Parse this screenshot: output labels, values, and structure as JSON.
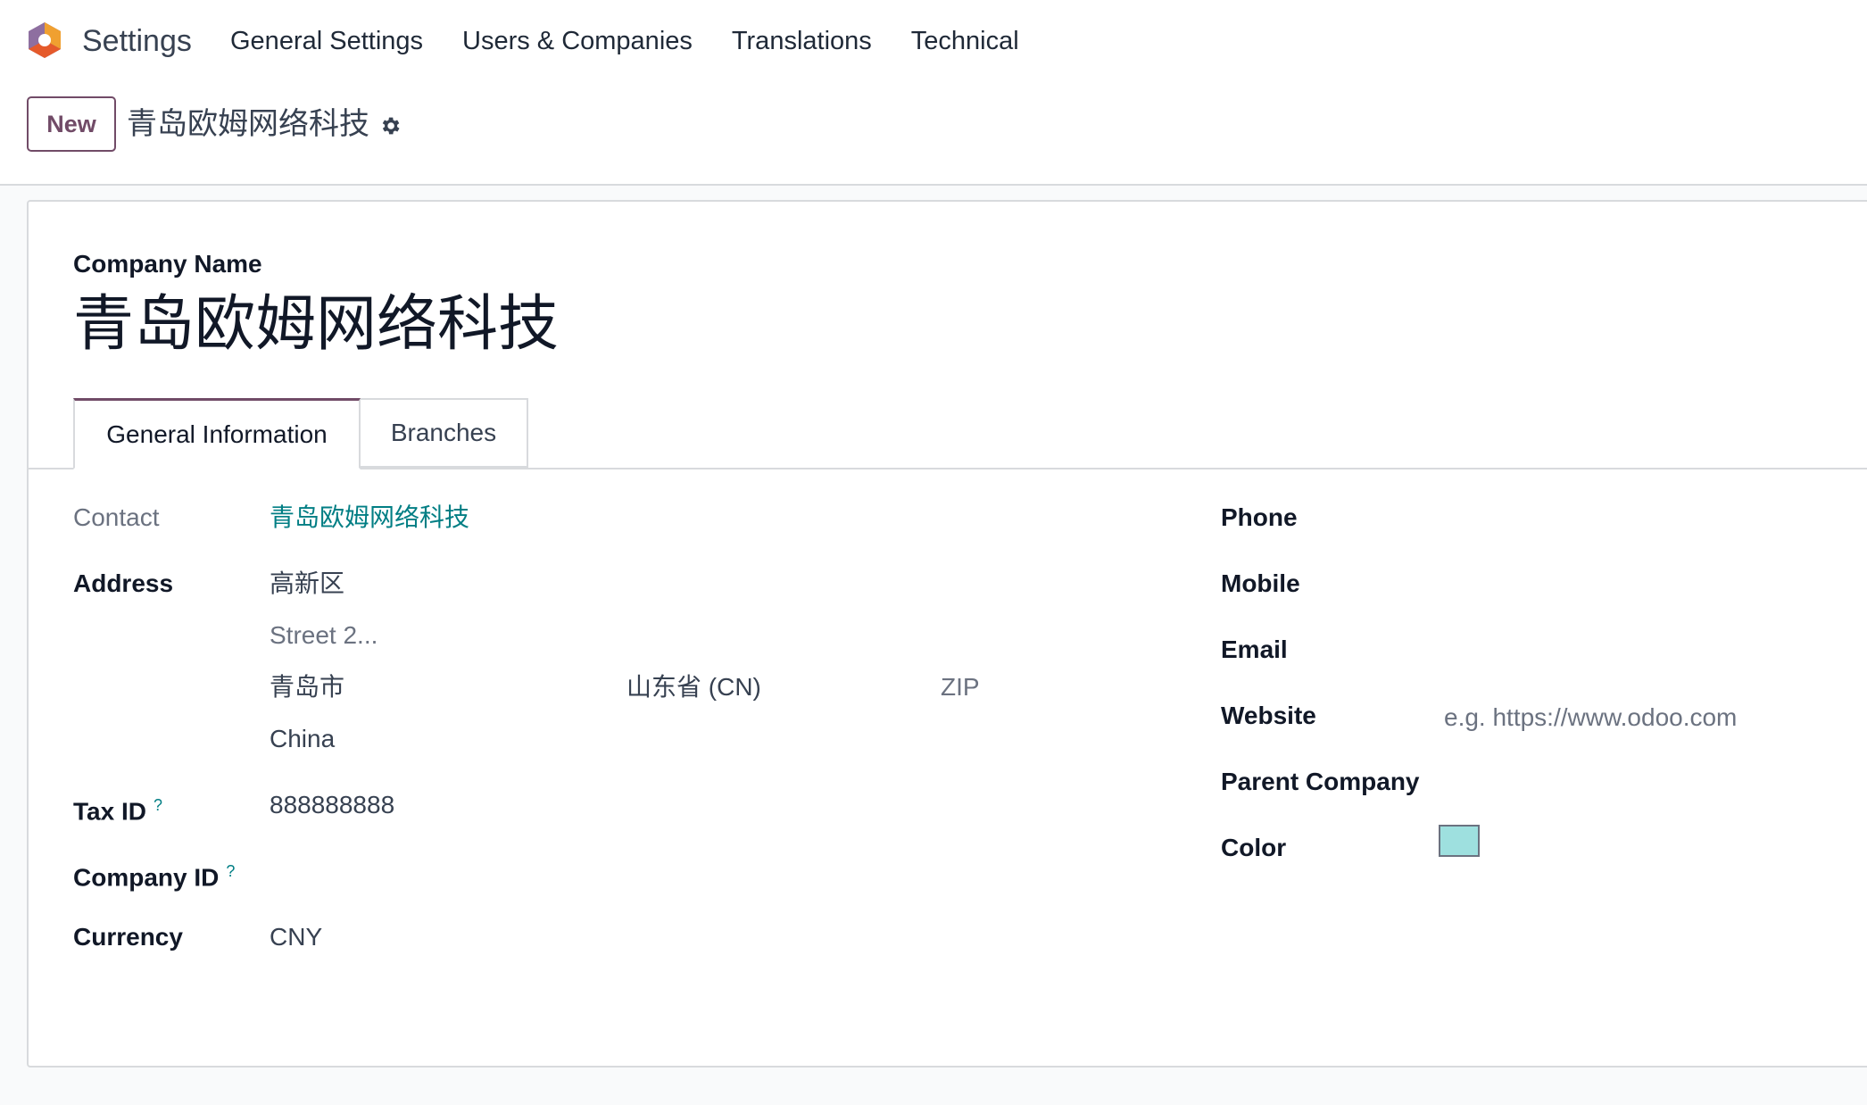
{
  "navbar": {
    "app_title": "Settings",
    "menu": [
      "General Settings",
      "Users & Companies",
      "Translations",
      "Technical"
    ]
  },
  "control_panel": {
    "new_button": "New",
    "record_name": "青岛欧姆网络科技"
  },
  "form": {
    "company_name_label": "Company Name",
    "company_name": "青岛欧姆网络科技",
    "tabs": [
      "General Information",
      "Branches"
    ],
    "active_tab": "General Information",
    "left": {
      "contact_label": "Contact",
      "contact_value": "青岛欧姆网络科技",
      "address_label": "Address",
      "street": "高新区",
      "street2_placeholder": "Street 2...",
      "city": "青岛市",
      "state": "山东省 (CN)",
      "zip_placeholder": "ZIP",
      "country": "China",
      "tax_id_label": "Tax ID",
      "tax_id_help": "?",
      "tax_id_value": "888888888",
      "company_id_label": "Company ID",
      "company_id_help": "?",
      "currency_label": "Currency",
      "currency_value": "CNY"
    },
    "right": {
      "phone_label": "Phone",
      "mobile_label": "Mobile",
      "email_label": "Email",
      "website_label": "Website",
      "website_placeholder": "e.g. https://www.odoo.com",
      "parent_company_label": "Parent Company",
      "color_label": "Color",
      "color_value": "#9ee0df"
    }
  },
  "colors": {
    "brand": "#714b67",
    "link": "#017e84"
  }
}
